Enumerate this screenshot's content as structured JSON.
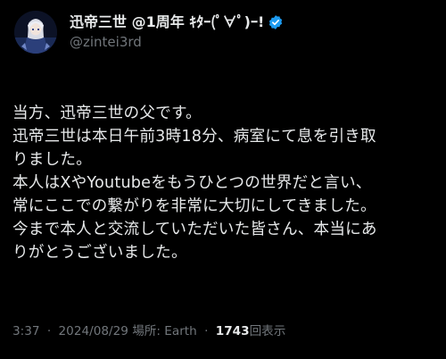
{
  "author": {
    "display_name": "迅帝三世 @1周年 ｷﾀｰ(ﾟ∀ﾟ)ｰ!",
    "handle": "@zintei3rd",
    "verified": true,
    "verified_color": "#1d9bf0",
    "avatar_icon": "avatar-character-icon"
  },
  "post": {
    "lines": [
      "当方、迅帝三世の父です。",
      "迅帝三世は本日午前3時18分、病室にて息を引き取",
      "りました。",
      "本人はXやYoutubeをもうひとつの世界だと言い、",
      "常にここでの繋がりを非常に大切にしてきました。",
      "今まで本人と交流していただいた皆さん、本当にあ",
      "りがとうございました。"
    ]
  },
  "meta": {
    "time": "3:37",
    "date": "2024/08/29",
    "location_label": "場所: Earth",
    "separator": "·",
    "views_count": "1743",
    "views_label": "回表示"
  },
  "colors": {
    "background": "#000000",
    "text_primary": "#e7e9ea",
    "text_secondary": "#71767b"
  }
}
